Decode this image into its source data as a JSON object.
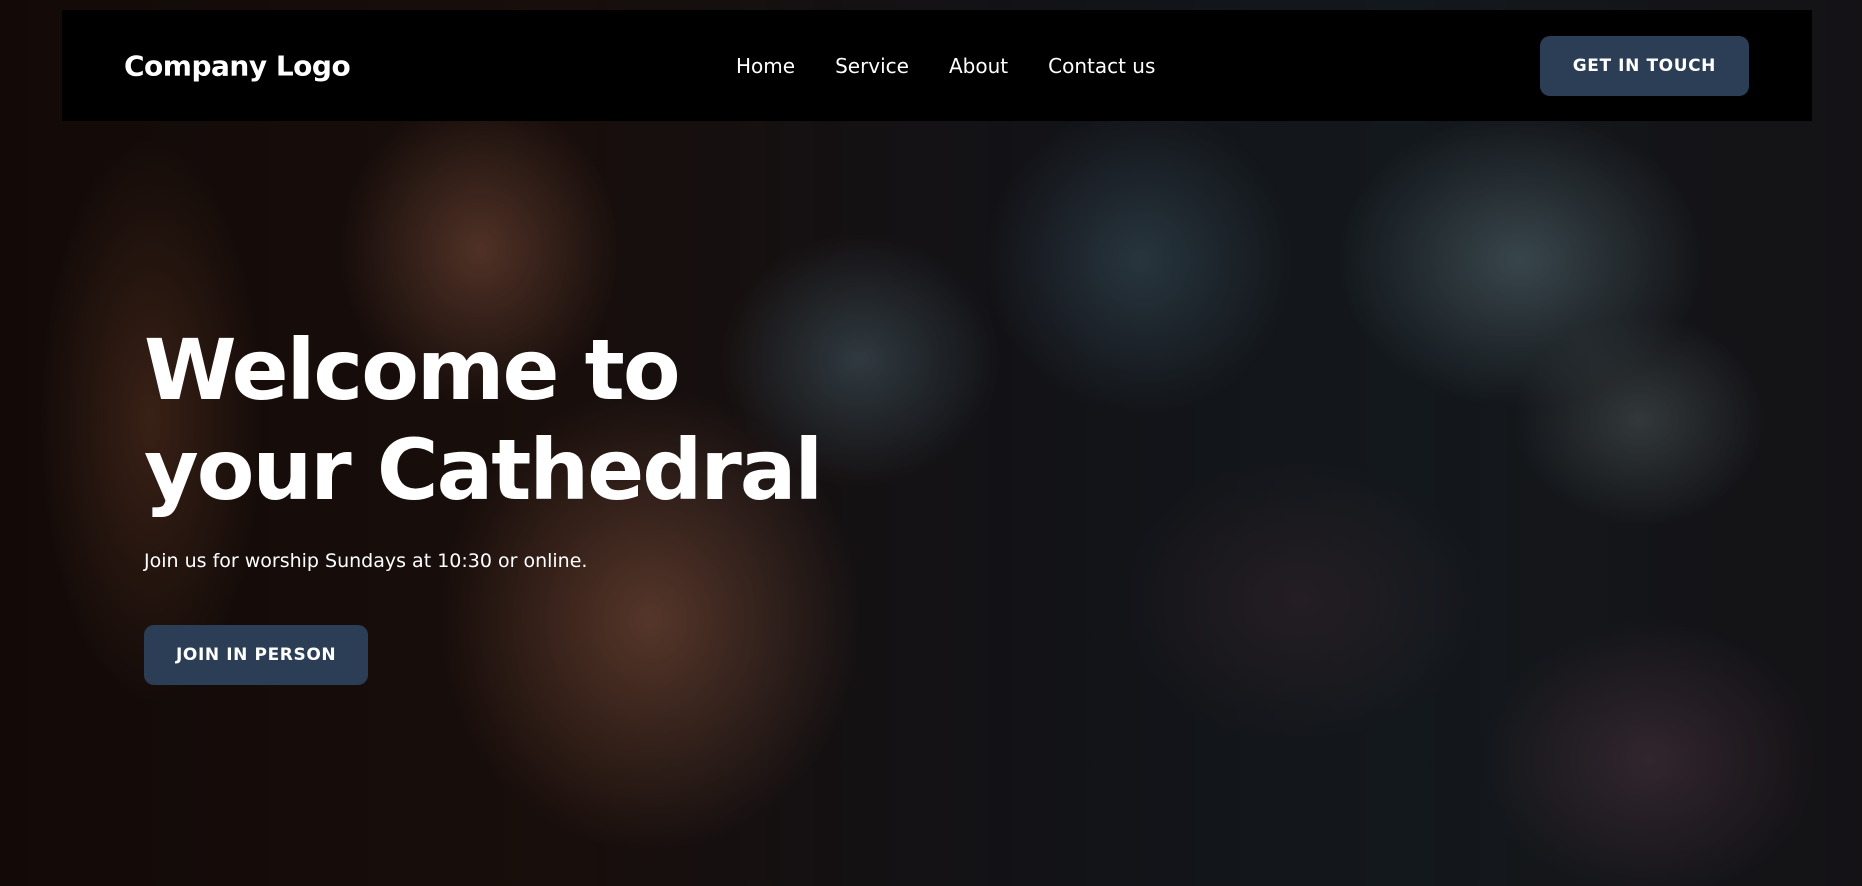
{
  "header": {
    "logo_text": "Company Logo",
    "nav": [
      {
        "label": "Home"
      },
      {
        "label": "Service"
      },
      {
        "label": "About"
      },
      {
        "label": "Contact us"
      }
    ],
    "cta_label": "GET IN TOUCH"
  },
  "hero": {
    "title": "Welcome to your Cathedral",
    "subtitle": "Join us for worship Sundays at 10:30 or online.",
    "cta_label": "JOIN IN PERSON"
  },
  "colors": {
    "navbar_bg": "#000000",
    "button_bg": "#2c3e55",
    "text": "#ffffff"
  }
}
